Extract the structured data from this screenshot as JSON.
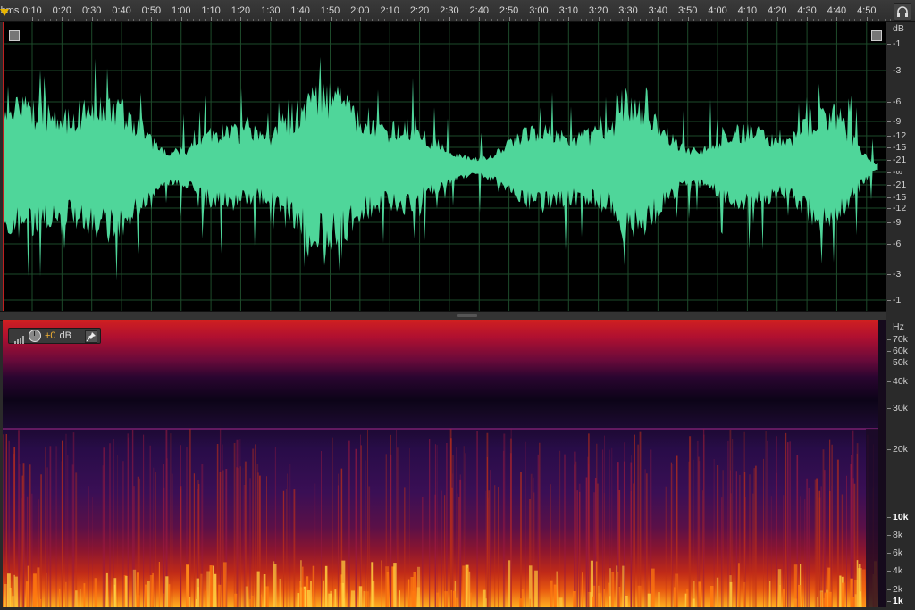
{
  "ruler": {
    "unit_label": "hms",
    "ticks": [
      "0:10",
      "0:20",
      "0:30",
      "0:40",
      "0:50",
      "1:00",
      "1:10",
      "1:20",
      "1:30",
      "1:40",
      "1:50",
      "2:00",
      "2:10",
      "2:20",
      "2:30",
      "2:40",
      "2:50",
      "3:00",
      "3:10",
      "3:20",
      "3:30",
      "3:40",
      "3:50",
      "4:00",
      "4:10",
      "4:20",
      "4:30",
      "4:40",
      "4:50"
    ]
  },
  "db_scale": {
    "unit": "dB",
    "labels": [
      "-1",
      "-3",
      "-6",
      "-9",
      "-12",
      "-15",
      "-21",
      "-∞",
      "-21",
      "-15",
      "-12",
      "-9",
      "-6",
      "-3",
      "-1"
    ]
  },
  "hz_scale": {
    "unit": "Hz",
    "labels": [
      "70k",
      "60k",
      "50k",
      "40k",
      "30k",
      "20k",
      "10k",
      "8k",
      "6k",
      "4k",
      "2k",
      "1k"
    ],
    "bold_labels": [
      "10k",
      "1k"
    ]
  },
  "spectral_toolbar": {
    "gain_value": "+0",
    "gain_unit": "dB"
  },
  "colors": {
    "waveform": "#4fd69a",
    "grid": "#1d4a2a",
    "accent_gain": "#f2b233",
    "playhead": "#e8b400"
  },
  "icons": {
    "headphones": "headphones-icon",
    "pin": "pin-icon",
    "knob": "gain-knob-icon",
    "bars": "signal-bars-icon"
  }
}
